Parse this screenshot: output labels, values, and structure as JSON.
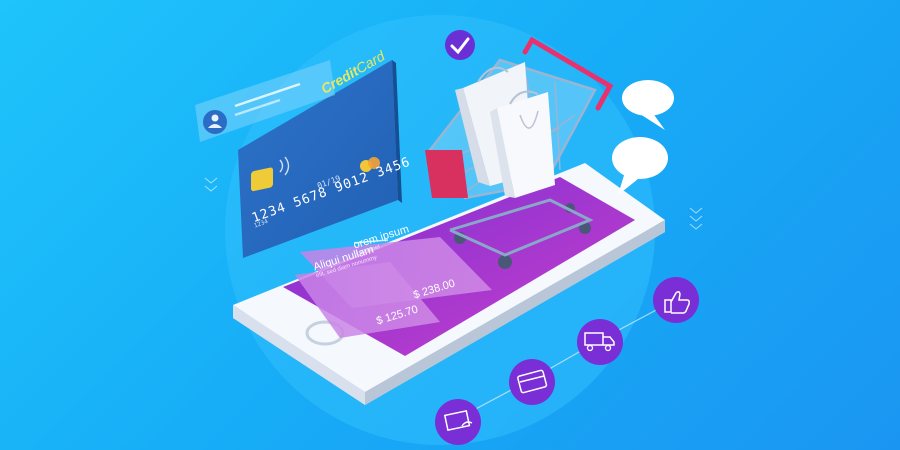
{
  "card": {
    "title_credit": "Credit",
    "title_card": "Card",
    "number": "1234 5678 9012 3456",
    "expiry": "01/19",
    "code": "1234"
  },
  "phone": {
    "items": [
      {
        "label": "orem ipsum",
        "sublabel": "r sit amet",
        "price": "$ 238.00"
      },
      {
        "label": "Aliqui nullam",
        "sublabel": "elit, sed diam nonummy",
        "price": "$ 125.70"
      }
    ]
  },
  "icons": {
    "check": "check-icon",
    "thumbs_up": "thumbs-up-icon",
    "truck": "delivery-truck-icon",
    "card": "credit-card-icon",
    "cash": "payment-hand-icon",
    "user": "user-icon",
    "speech": "speech-bubble-icon",
    "cart": "shopping-cart-icon",
    "bag": "shopping-bag-icon",
    "chip": "card-chip-icon",
    "contactless": "contactless-icon",
    "home_button": "home-button-icon"
  },
  "colors": {
    "background": "#1fb4f8",
    "phone_screen": "#b43fd0",
    "cart_accent": "#e8326e",
    "circle_icon": "#7a2fd6",
    "card": "#2d73c9",
    "card_title": "#e8e860"
  }
}
